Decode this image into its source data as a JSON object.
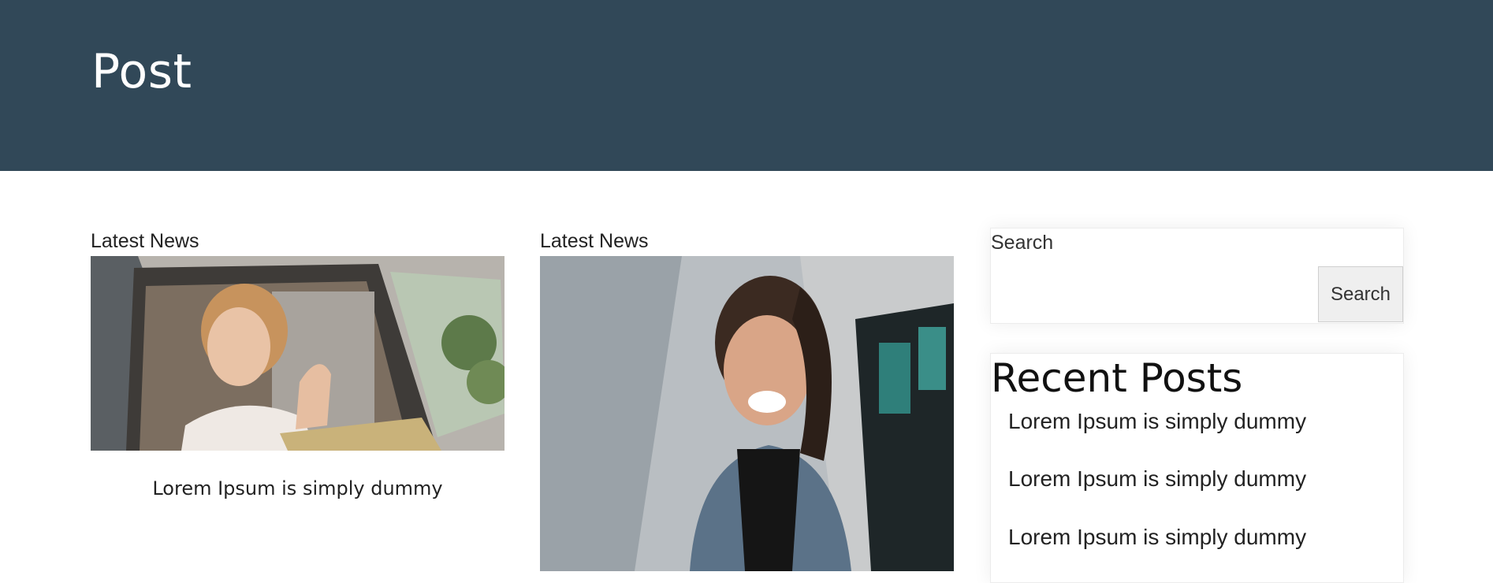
{
  "header": {
    "title": "Post"
  },
  "columns": [
    {
      "label": "Latest News",
      "post_title": "Lorem Ipsum is simply dummy",
      "image": "bride-in-car-window-photo"
    },
    {
      "label": "Latest News",
      "image": "laughing-woman-denim-jacket-photo"
    }
  ],
  "sidebar": {
    "search": {
      "label": "Search",
      "placeholder": "",
      "button_label": "Search"
    },
    "recent_posts": {
      "title": "Recent Posts",
      "items": [
        "Lorem Ipsum is simply dummy",
        "Lorem Ipsum is simply dummy",
        "Lorem Ipsum is simply dummy"
      ]
    }
  },
  "colors": {
    "hero_background": "#314858",
    "hero_text": "#ffffff"
  }
}
